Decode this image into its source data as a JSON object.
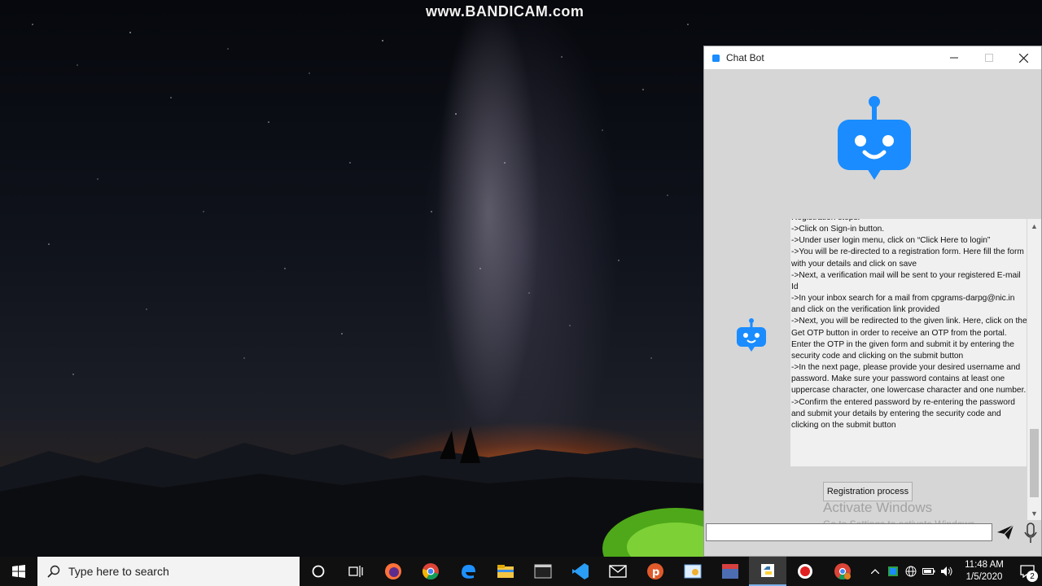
{
  "desktop": {
    "watermark_text": "www.BANDICAM.com"
  },
  "window": {
    "title": "Chat Bot",
    "controls": {
      "minimize": "—",
      "maximize": "☐",
      "close": "✕"
    },
    "message": "Registration steps:\n->Click on Sign-in button.\n->Under user login menu, click on “Click Here to login”\n->You will be re-directed to a registration form. Here fill the form with your details and click on save\n->Next, a verification mail will be sent to your registered E-mail Id\n->In your inbox search for a mail from cpgrams-darpg@nic.in and click on the verification link provided\n->Next, you will be redirected to the given link. Here, click on the Get OTP button in order to receive an OTP from the portal. Enter the OTP in the given form and submit it by entering the security code and clicking on the submit button\n->In the next page, please provide your desired username and password. Make sure your password contains at least one uppercase character, one lowercase character and one number.\n->Confirm the entered password by re-entering the password and submit your details by entering the security code and clicking on the submit button",
    "suggestion_button": "Registration process",
    "activation": {
      "line1": "Activate Windows",
      "line2": "Go to Settings to activate Windows."
    },
    "input_value": "",
    "colors": {
      "bot_blue": "#1a8cff",
      "window_bg": "#d6d6d6"
    }
  },
  "taskbar": {
    "search_placeholder": "Type here to search",
    "apps": [
      "cortana-icon",
      "task-view-icon",
      "firefox-icon",
      "chrome-icon",
      "edge-icon",
      "file-explorer-icon",
      "terminal-icon",
      "vscode-icon",
      "mail-icon",
      "postman-icon",
      "paint-icon",
      "devcpp-icon",
      "python-icon",
      "record-icon",
      "chrome-profile-icon"
    ],
    "clock": {
      "time": "11:48 AM",
      "date": "1/5/2020"
    },
    "notification_count": "2"
  }
}
